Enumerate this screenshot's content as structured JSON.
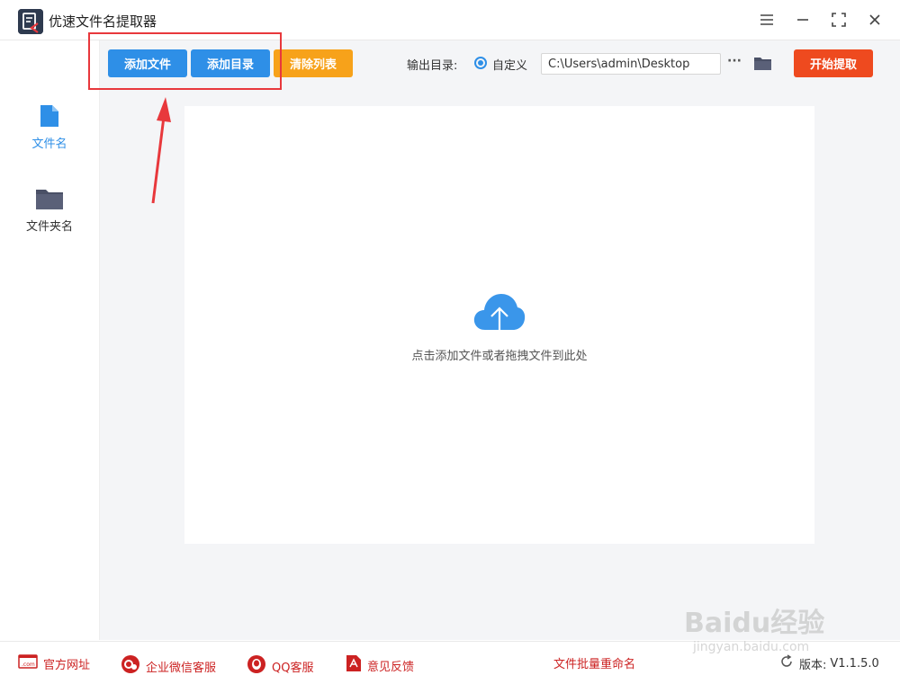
{
  "app": {
    "title": "优速文件名提取器"
  },
  "window_controls": [
    "menu-icon",
    "minimize-icon",
    "maximize-icon",
    "close-icon"
  ],
  "sidebar": {
    "items": [
      {
        "label": "文件名",
        "icon": "file-icon",
        "active": true
      },
      {
        "label": "文件夹名",
        "icon": "folder-icon",
        "active": false
      }
    ]
  },
  "toolbar": {
    "add_file": "添加文件",
    "add_dir": "添加目录",
    "clear_list": "清除列表",
    "output_label": "输出目录:",
    "custom_option": "自定义",
    "output_path": "C:\\Users\\admin\\Desktop",
    "more": "···",
    "start": "开始提取"
  },
  "drop": {
    "hint": "点击添加文件或者拖拽文件到此处"
  },
  "footer": {
    "website": "官方网址",
    "wechat": "企业微信客服",
    "qq": "QQ客服",
    "feedback": "意见反馈",
    "batch_rename": "文件批量重命名",
    "version_label": "版本:",
    "version": "V1.1.5.0"
  },
  "watermark": {
    "brand": "Baidu经验",
    "url": "jingyan.baidu.com"
  },
  "colors": {
    "primary": "#2e8fe7",
    "orange": "#f7a21a",
    "start": "#ee4a1f",
    "annotation": "#e8383c"
  }
}
